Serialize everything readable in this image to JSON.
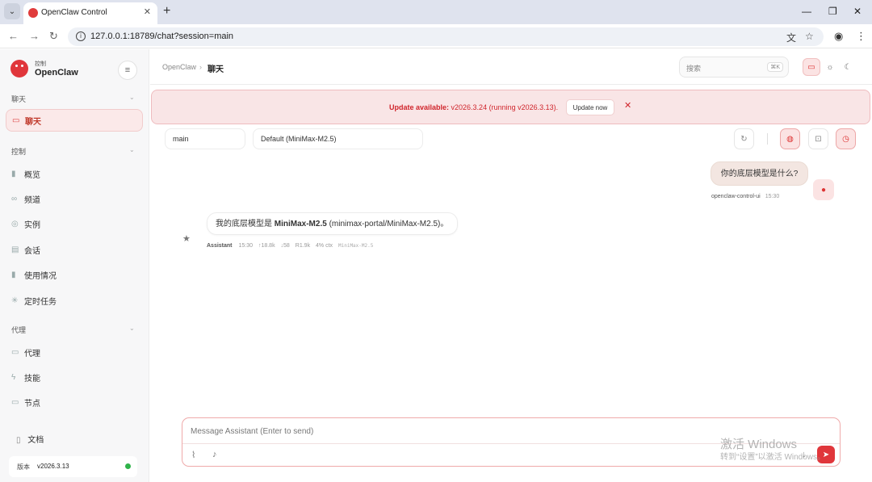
{
  "browser": {
    "tab_title": "OpenClaw Control",
    "url": "127.0.0.1:18789/chat?session=main",
    "new_tab_label": "+",
    "tab_close": "✕",
    "min_label": "—",
    "max_label": "❐",
    "close_label": "✕"
  },
  "sidebar": {
    "brand_sub": "控制",
    "brand": "OpenClaw",
    "sections": [
      {
        "title": "聊天",
        "items": [
          {
            "label": "聊天",
            "icon": "message-icon",
            "active": true
          }
        ]
      },
      {
        "title": "控制",
        "items": [
          {
            "label": "概览",
            "icon": "bar-chart-icon"
          },
          {
            "label": "频道",
            "icon": "link-icon"
          },
          {
            "label": "实例",
            "icon": "radio-icon"
          },
          {
            "label": "会话",
            "icon": "file-icon"
          },
          {
            "label": "使用情况",
            "icon": "bar-chart-icon"
          },
          {
            "label": "定时任务",
            "icon": "loader-icon"
          }
        ]
      },
      {
        "title": "代理",
        "items": [
          {
            "label": "代理",
            "icon": "folder-icon"
          },
          {
            "label": "技能",
            "icon": "zap-icon"
          },
          {
            "label": "节点",
            "icon": "monitor-icon"
          }
        ]
      }
    ],
    "docs_label": "文档",
    "version_label": "版本",
    "version_value": "v2026.3.13",
    "status_color": "#2fb34a"
  },
  "topbar": {
    "breadcrumb_root": "OpenClaw",
    "breadcrumb_sep": "›",
    "breadcrumb_current": "聊天",
    "search_placeholder": "搜索",
    "search_shortcut": "⌘K"
  },
  "banner": {
    "bold": "Update available:",
    "text": " v2026.3.24 (running v2026.3.13).",
    "button": "Update now",
    "close": "✕"
  },
  "chat_controls": {
    "session": "main",
    "model": "Default (MiniMax-M2.5)"
  },
  "messages": {
    "user": {
      "text": "你的底层模型是什么?",
      "sender": "openclaw-control-ui",
      "time": "15:30"
    },
    "assistant": {
      "prefix": "我的底层模型是 ",
      "bold": "MiniMax-M2.5",
      "suffix": " (minimax-portal/MiniMax-M2.5)。",
      "sender": "Assistant",
      "time": "15:30",
      "input_tokens": "↑18.8k",
      "output_tokens": "↓58",
      "read_tokens": "R1.9k",
      "ctx": "4% ctx",
      "model": "MiniMax-M2.5"
    }
  },
  "composer": {
    "placeholder": "Message Assistant (Enter to send)"
  },
  "watermark": {
    "title": "激活 Windows",
    "subtitle": "转到“设置”以激活 Windows。"
  },
  "colors": {
    "accent": "#e0363b",
    "banner_bg": "#f9e5e6",
    "active_nav_bg": "#fbe9e9"
  }
}
